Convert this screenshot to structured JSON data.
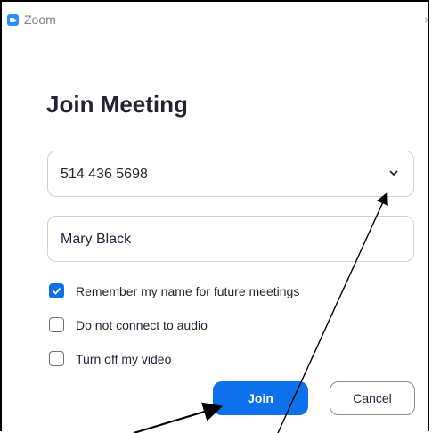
{
  "window": {
    "title": "Zoom",
    "icon": "zoom-logo-icon",
    "close_icon": "close-icon",
    "close_glyph": "×"
  },
  "heading": "Join Meeting",
  "meeting_id": {
    "value": "514 436 5698",
    "dropdown_icon": "chevron-down-icon"
  },
  "name": {
    "value": "Mary Black"
  },
  "options": [
    {
      "label": "Remember my name for future meetings",
      "checked": true
    },
    {
      "label": "Do not connect to audio",
      "checked": false
    },
    {
      "label": "Turn off my video",
      "checked": false
    }
  ],
  "buttons": {
    "join": "Join",
    "cancel": "Cancel"
  },
  "colors": {
    "accent": "#0e71eb",
    "zoom_blue": "#2d8cff",
    "annotation": "#000000"
  },
  "annotations": [
    "arrow pointing to Join button",
    "arrow pointing to meeting ID dropdown chevron"
  ]
}
